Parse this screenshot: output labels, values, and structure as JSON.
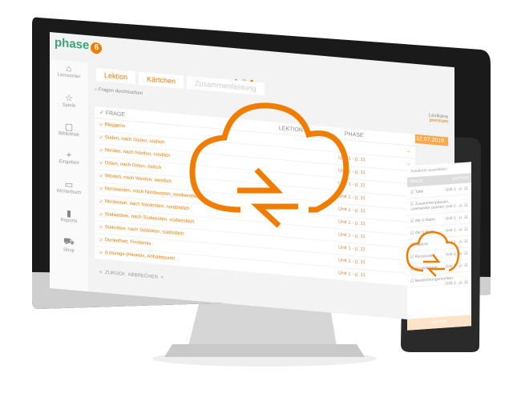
{
  "brand": {
    "name": "phase",
    "mark": "6",
    "accent": "#f07d00",
    "green": "#3aa37a"
  },
  "sidebar": [
    "Lerncenter",
    "Spiele",
    "Bibliothek",
    "Eingeben",
    "Wörterbuch",
    "Reports",
    "Shop"
  ],
  "tabs": [
    "Lektion",
    "Kärtchen",
    "Zusammenfassung"
  ],
  "search_placeholder": "Fragen durchsuchen",
  "user": {
    "name": "Lexikana",
    "status": "premium"
  },
  "date": "12.07.2019",
  "table": {
    "col_question": "FRAGE",
    "col_lesson": "LEKTION",
    "col_phase": "PHASE",
    "rows": [
      {
        "q": "Bloggerin",
        "l": ""
      },
      {
        "q": "Süden, nach Süden, südlich",
        "l": "Unit 1 - p. 11"
      },
      {
        "q": "Norden, nach Norden, nördlich",
        "l": "Unit 1 - p. 11"
      },
      {
        "q": "Osten, nach Osten, östlich",
        "l": "Unit 1 - p. 11"
      },
      {
        "q": "Westen, nach Westen, westlich",
        "l": "Unit 1 - p. 11"
      },
      {
        "q": "Nordwesten, nach Nordwesten, nordwestlich",
        "l": "Unit 1 - p. 11"
      },
      {
        "q": "Nordosten, nach Nordosten, nordöstlich",
        "l": "Unit 1 - p. 11"
      },
      {
        "q": "Südwesten, nach Südwesten, südwestlich",
        "l": "Unit 1 - p. 11"
      },
      {
        "q": "Südosten, nach Südosten, südöstlich",
        "l": "Unit 1 - p. 11"
      },
      {
        "q": "Dunkelheit, Finsternis",
        "l": "Unit 1 - p. 11"
      },
      {
        "q": "(Lösungs-)Hinweis, Anhaltspunkt",
        "l": "Unit 1 - p. 11"
      }
    ]
  },
  "footer": {
    "back": "< ZURÜCK",
    "cancel": "ABBRECHEN ×"
  },
  "phone": {
    "title": "Vokabeln auswählen",
    "col_question": "FRAGE",
    "col_lesson": "LEKTION",
    "rows": [
      "Tafel",
      "Zusammenpassen, zueinander passen",
      "die U-Bahn",
      "die U-Bahn",
      "Galerie",
      "Restaurant",
      "Bestimmung",
      "Bestimmungsrechten"
    ],
    "unit": "Unit 1 - p. 11",
    "button": "WEITER"
  }
}
